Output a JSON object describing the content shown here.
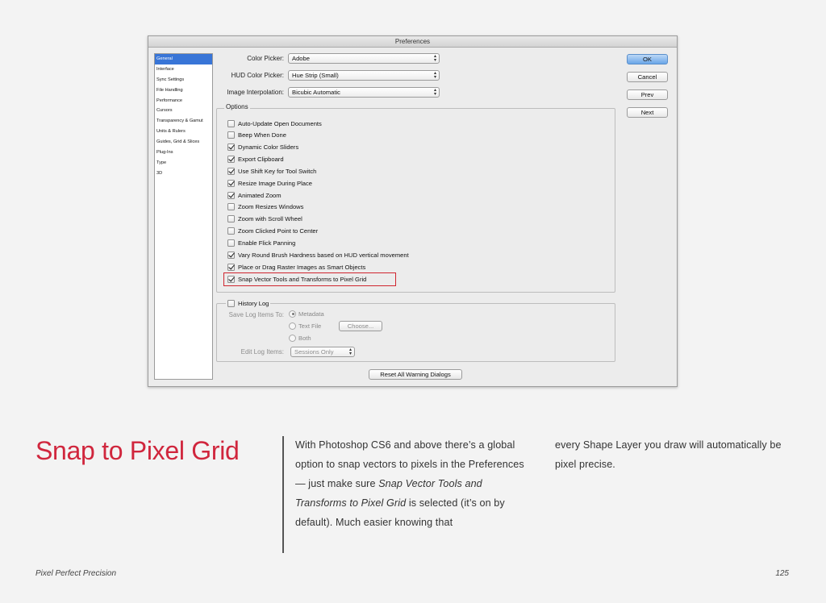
{
  "dialog": {
    "title": "Preferences",
    "sidebar": [
      "General",
      "Interface",
      "Sync Settings",
      "File Handling",
      "Performance",
      "Cursors",
      "Transparency & Gamut",
      "Units & Rulers",
      "Guides, Grid & Slices",
      "Plug-Ins",
      "Type",
      "3D"
    ],
    "fields": {
      "color_picker_label": "Color Picker:",
      "color_picker_value": "Adobe",
      "hud_label": "HUD Color Picker:",
      "hud_value": "Hue Strip (Small)",
      "interp_label": "Image Interpolation:",
      "interp_value": "Bicubic Automatic"
    },
    "options_title": "Options",
    "options": [
      {
        "label": "Auto-Update Open Documents",
        "checked": false
      },
      {
        "label": "Beep When Done",
        "checked": false
      },
      {
        "label": "Dynamic Color Sliders",
        "checked": true
      },
      {
        "label": "Export Clipboard",
        "checked": true
      },
      {
        "label": "Use Shift Key for Tool Switch",
        "checked": true
      },
      {
        "label": "Resize Image During Place",
        "checked": true
      },
      {
        "label": "Animated Zoom",
        "checked": true
      },
      {
        "label": "Zoom Resizes Windows",
        "checked": false
      },
      {
        "label": "Zoom with Scroll Wheel",
        "checked": false
      },
      {
        "label": "Zoom Clicked Point to Center",
        "checked": false
      },
      {
        "label": "Enable Flick Panning",
        "checked": false
      },
      {
        "label": "Vary Round Brush Hardness based on HUD vertical movement",
        "checked": true
      },
      {
        "label": "Place or Drag Raster Images as Smart Objects",
        "checked": true
      },
      {
        "label": "Snap Vector Tools and Transforms to Pixel Grid",
        "checked": true
      }
    ],
    "history": {
      "title": "History Log",
      "save_label": "Save Log Items To:",
      "radio_metadata": "Metadata",
      "radio_textfile": "Text File",
      "radio_both": "Both",
      "choose_button": "Choose...",
      "edit_label": "Edit Log Items:",
      "edit_value": "Sessions Only"
    },
    "reset_button": "Reset All Warning Dialogs",
    "buttons": {
      "ok": "OK",
      "cancel": "Cancel",
      "prev": "Prev",
      "next": "Next"
    }
  },
  "page": {
    "heading": "Snap to Pixel Grid",
    "col1_a": "With Photoshop CS6 and above there’s a global option to snap vectors to pixels in the Preferences — just make sure ",
    "col1_em": "Snap Vector Tools and Transforms to Pixel Grid",
    "col1_b": " is selected (it’s on by default). Much easier knowing that",
    "col2": "every Shape Layer you draw will automatically be pixel precise.",
    "footer_title": "Pixel Perfect Precision",
    "page_number": "125"
  },
  "colors": {
    "heading": "#d0263d",
    "highlight": "#d0262f",
    "selection": "#3875d7"
  }
}
